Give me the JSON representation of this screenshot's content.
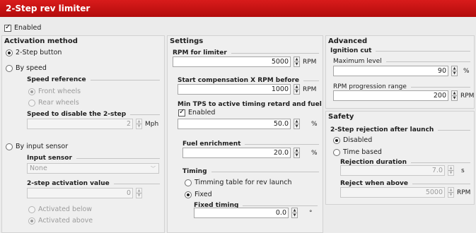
{
  "window": {
    "title": "2-Step rev limiter"
  },
  "enabled": {
    "label": "Enabled",
    "checked": true
  },
  "activation": {
    "title": "Activation method",
    "options": {
      "two_step_button": "2-Step button",
      "by_speed": "By speed",
      "by_input_sensor": "By input sensor"
    },
    "selected": "2-Step button",
    "speed_reference": {
      "label": "Speed reference",
      "front": "Front wheels",
      "rear": "Rear wheels",
      "selected": "Front wheels"
    },
    "speed_disable": {
      "label": "Speed to disable the 2-step",
      "value": "2",
      "unit": "Mph"
    },
    "input_sensor": {
      "label": "Input sensor",
      "value": "None"
    },
    "activation_value": {
      "label": "2-step activation value",
      "value": "0"
    },
    "activated": {
      "below": "Activated below",
      "above": "Activated above",
      "selected": "Activated above"
    }
  },
  "settings": {
    "title": "Settings",
    "rpm_limiter": {
      "label": "RPM for limiter",
      "value": "5000",
      "unit": "RPM"
    },
    "start_comp": {
      "label": "Start compensation X RPM before",
      "value": "1000",
      "unit": "RPM"
    },
    "min_tps": {
      "label": "Min TPS to active timing retard and fuel",
      "enabled_label": "Enabled",
      "enabled": true,
      "value": "50.0",
      "unit": "%"
    },
    "fuel_enrichment": {
      "label": "Fuel enrichment",
      "value": "20.0",
      "unit": "%"
    },
    "timing": {
      "label": "Timing",
      "table_option": "Timming table for rev launch",
      "fixed_option": "Fixed",
      "selected": "Fixed"
    },
    "fixed_timing": {
      "label": "Fixed timing",
      "value": "0.0",
      "unit": "°"
    }
  },
  "advanced": {
    "title": "Advanced",
    "ignition_cut": {
      "label": "Ignition cut"
    },
    "max_level": {
      "label": "Maximum level",
      "value": "90",
      "unit": "%"
    },
    "rpm_progression": {
      "label": "RPM progression range",
      "value": "200",
      "unit": "RPM"
    }
  },
  "safety": {
    "title": "Safety",
    "rejection": {
      "label": "2-Step rejection after launch",
      "disabled": "Disabled",
      "time_based": "Time based",
      "selected": "Disabled"
    },
    "rejection_duration": {
      "label": "Rejection duration",
      "value": "7.0",
      "unit": "s"
    },
    "reject_above": {
      "label": "Reject when above",
      "value": "5000",
      "unit": "RPM"
    }
  },
  "icons": {
    "spin_up": "▲",
    "spin_down": "▼",
    "dropdown": "﹀"
  }
}
